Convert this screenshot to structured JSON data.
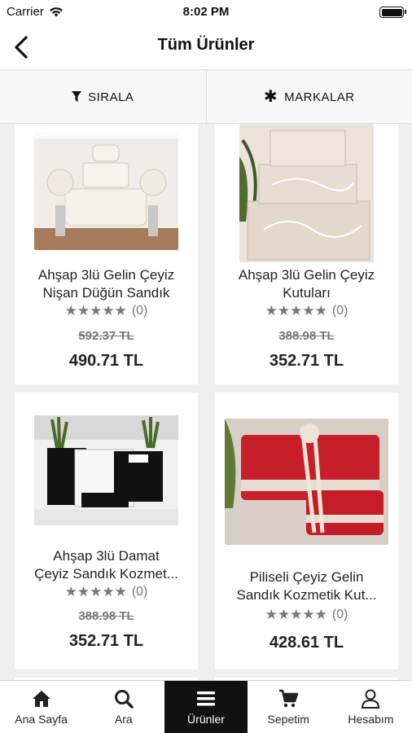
{
  "status": {
    "carrier": "Carrier",
    "time": "8:02 PM"
  },
  "nav": {
    "title": "Tüm Ürünler"
  },
  "filters": {
    "sort_label": "SIRALA",
    "brands_label": "MARKALAR"
  },
  "products": [
    {
      "name_line1": "Ahşap 3lü Gelin Çeyiz",
      "name_line2": "Nişan Düğün Sandık",
      "stars": "★★★★★",
      "rating_count": "(0)",
      "old_price": "592.37 TL",
      "price": "490.71 TL"
    },
    {
      "name_line1": "Ahşap 3lü Gelin Çeyiz",
      "name_line2": "Kutuları",
      "stars": "★★★★★",
      "rating_count": "(0)",
      "old_price": "388.98 TL",
      "price": "352.71 TL"
    },
    {
      "name_line1": "Ahşap 3lü Damat",
      "name_line2": "Çeyiz Sandık Kozmet...",
      "stars": "★★★★★",
      "rating_count": "(0)",
      "old_price": "388.98 TL",
      "price": "352.71 TL"
    },
    {
      "name_line1": "Piliseli Çeyiz Gelin",
      "name_line2": "Sandık Kozmetik Kut...",
      "stars": "★★★★★",
      "rating_count": "(0)",
      "old_price": "",
      "price": "428.61 TL"
    }
  ],
  "tabs": [
    {
      "label": "Ana Sayfa",
      "icon": "home-icon"
    },
    {
      "label": "Ara",
      "icon": "search-icon"
    },
    {
      "label": "Ürünler",
      "icon": "menu-icon",
      "active": true
    },
    {
      "label": "Sepetim",
      "icon": "cart-icon"
    },
    {
      "label": "Hesabım",
      "icon": "user-icon"
    }
  ],
  "colors": {
    "active_tab": "#111111",
    "star": "#777777",
    "background": "#efefef"
  }
}
